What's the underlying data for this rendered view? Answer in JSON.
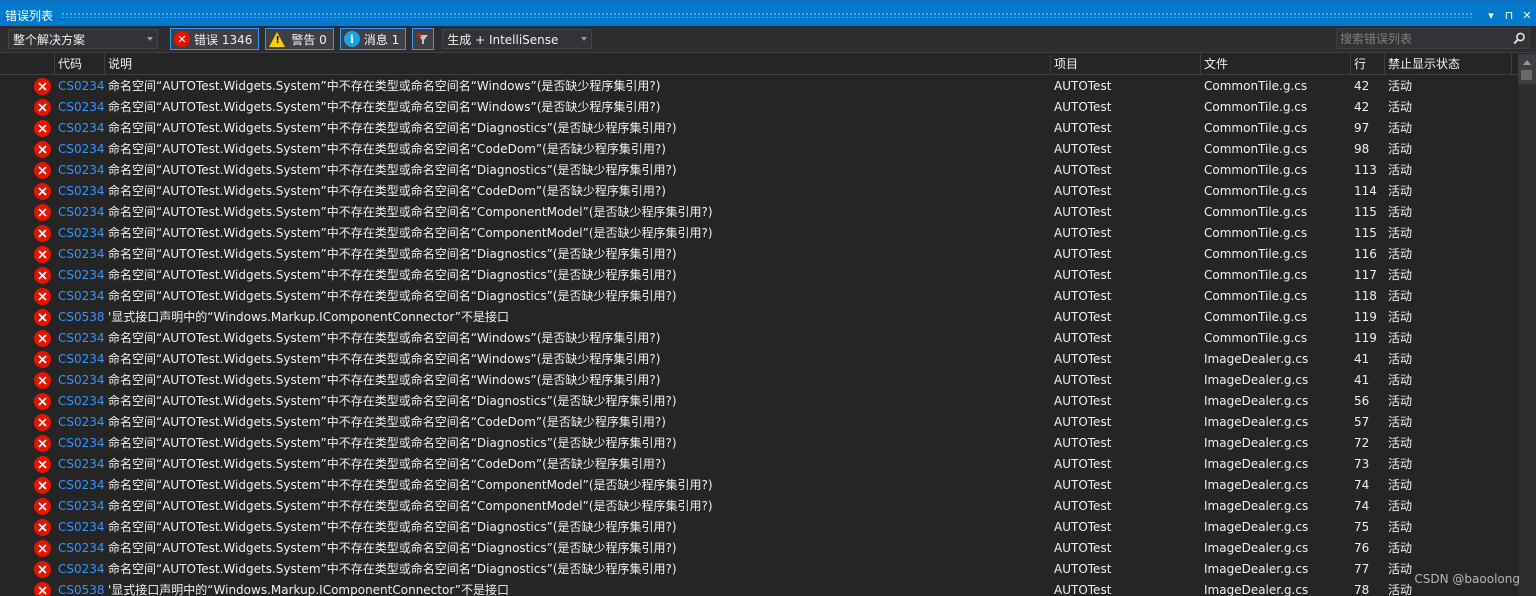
{
  "window": {
    "title": "错误列表",
    "buttons": [
      "▾",
      "⊓",
      "✕"
    ]
  },
  "toolbar": {
    "scope_dropdown": "整个解决方案",
    "errors_label": "错误 1346",
    "warnings_label": "警告 0",
    "messages_label": "消息 1",
    "source_dropdown": "生成 + IntelliSense",
    "search_placeholder": "搜索错误列表"
  },
  "columns": {
    "code": "代码",
    "description": "说明",
    "project": "项目",
    "file": "文件",
    "line": "行",
    "suppression": "禁止显示状态"
  },
  "rows": [
    {
      "code": "CS0234",
      "desc": "命名空间“AUTOTest.Widgets.System”中不存在类型或命名空间名“Windows”(是否缺少程序集引用?)",
      "project": "AUTOTest",
      "file": "CommonTile.g.cs",
      "line": "42",
      "state": "活动"
    },
    {
      "code": "CS0234",
      "desc": "命名空间“AUTOTest.Widgets.System”中不存在类型或命名空间名“Windows”(是否缺少程序集引用?)",
      "project": "AUTOTest",
      "file": "CommonTile.g.cs",
      "line": "42",
      "state": "活动"
    },
    {
      "code": "CS0234",
      "desc": "命名空间“AUTOTest.Widgets.System”中不存在类型或命名空间名“Diagnostics”(是否缺少程序集引用?)",
      "project": "AUTOTest",
      "file": "CommonTile.g.cs",
      "line": "97",
      "state": "活动"
    },
    {
      "code": "CS0234",
      "desc": "命名空间“AUTOTest.Widgets.System”中不存在类型或命名空间名“CodeDom”(是否缺少程序集引用?)",
      "project": "AUTOTest",
      "file": "CommonTile.g.cs",
      "line": "98",
      "state": "活动"
    },
    {
      "code": "CS0234",
      "desc": "命名空间“AUTOTest.Widgets.System”中不存在类型或命名空间名“Diagnostics”(是否缺少程序集引用?)",
      "project": "AUTOTest",
      "file": "CommonTile.g.cs",
      "line": "113",
      "state": "活动"
    },
    {
      "code": "CS0234",
      "desc": "命名空间“AUTOTest.Widgets.System”中不存在类型或命名空间名“CodeDom”(是否缺少程序集引用?)",
      "project": "AUTOTest",
      "file": "CommonTile.g.cs",
      "line": "114",
      "state": "活动"
    },
    {
      "code": "CS0234",
      "desc": "命名空间“AUTOTest.Widgets.System”中不存在类型或命名空间名“ComponentModel”(是否缺少程序集引用?)",
      "project": "AUTOTest",
      "file": "CommonTile.g.cs",
      "line": "115",
      "state": "活动"
    },
    {
      "code": "CS0234",
      "desc": "命名空间“AUTOTest.Widgets.System”中不存在类型或命名空间名“ComponentModel”(是否缺少程序集引用?)",
      "project": "AUTOTest",
      "file": "CommonTile.g.cs",
      "line": "115",
      "state": "活动"
    },
    {
      "code": "CS0234",
      "desc": "命名空间“AUTOTest.Widgets.System”中不存在类型或命名空间名“Diagnostics”(是否缺少程序集引用?)",
      "project": "AUTOTest",
      "file": "CommonTile.g.cs",
      "line": "116",
      "state": "活动"
    },
    {
      "code": "CS0234",
      "desc": "命名空间“AUTOTest.Widgets.System”中不存在类型或命名空间名“Diagnostics”(是否缺少程序集引用?)",
      "project": "AUTOTest",
      "file": "CommonTile.g.cs",
      "line": "117",
      "state": "活动"
    },
    {
      "code": "CS0234",
      "desc": "命名空间“AUTOTest.Widgets.System”中不存在类型或命名空间名“Diagnostics”(是否缺少程序集引用?)",
      "project": "AUTOTest",
      "file": "CommonTile.g.cs",
      "line": "118",
      "state": "活动"
    },
    {
      "code": "CS0538",
      "desc": "'显式接口声明中的“Windows.Markup.IComponentConnector”不是接口",
      "project": "AUTOTest",
      "file": "CommonTile.g.cs",
      "line": "119",
      "state": "活动"
    },
    {
      "code": "CS0234",
      "desc": "命名空间“AUTOTest.Widgets.System”中不存在类型或命名空间名“Windows”(是否缺少程序集引用?)",
      "project": "AUTOTest",
      "file": "CommonTile.g.cs",
      "line": "119",
      "state": "活动"
    },
    {
      "code": "CS0234",
      "desc": "命名空间“AUTOTest.Widgets.System”中不存在类型或命名空间名“Windows”(是否缺少程序集引用?)",
      "project": "AUTOTest",
      "file": "ImageDealer.g.cs",
      "line": "41",
      "state": "活动"
    },
    {
      "code": "CS0234",
      "desc": "命名空间“AUTOTest.Widgets.System”中不存在类型或命名空间名“Windows”(是否缺少程序集引用?)",
      "project": "AUTOTest",
      "file": "ImageDealer.g.cs",
      "line": "41",
      "state": "活动"
    },
    {
      "code": "CS0234",
      "desc": "命名空间“AUTOTest.Widgets.System”中不存在类型或命名空间名“Diagnostics”(是否缺少程序集引用?)",
      "project": "AUTOTest",
      "file": "ImageDealer.g.cs",
      "line": "56",
      "state": "活动"
    },
    {
      "code": "CS0234",
      "desc": "命名空间“AUTOTest.Widgets.System”中不存在类型或命名空间名“CodeDom”(是否缺少程序集引用?)",
      "project": "AUTOTest",
      "file": "ImageDealer.g.cs",
      "line": "57",
      "state": "活动"
    },
    {
      "code": "CS0234",
      "desc": "命名空间“AUTOTest.Widgets.System”中不存在类型或命名空间名“Diagnostics”(是否缺少程序集引用?)",
      "project": "AUTOTest",
      "file": "ImageDealer.g.cs",
      "line": "72",
      "state": "活动"
    },
    {
      "code": "CS0234",
      "desc": "命名空间“AUTOTest.Widgets.System”中不存在类型或命名空间名“CodeDom”(是否缺少程序集引用?)",
      "project": "AUTOTest",
      "file": "ImageDealer.g.cs",
      "line": "73",
      "state": "活动"
    },
    {
      "code": "CS0234",
      "desc": "命名空间“AUTOTest.Widgets.System”中不存在类型或命名空间名“ComponentModel”(是否缺少程序集引用?)",
      "project": "AUTOTest",
      "file": "ImageDealer.g.cs",
      "line": "74",
      "state": "活动"
    },
    {
      "code": "CS0234",
      "desc": "命名空间“AUTOTest.Widgets.System”中不存在类型或命名空间名“ComponentModel”(是否缺少程序集引用?)",
      "project": "AUTOTest",
      "file": "ImageDealer.g.cs",
      "line": "74",
      "state": "活动"
    },
    {
      "code": "CS0234",
      "desc": "命名空间“AUTOTest.Widgets.System”中不存在类型或命名空间名“Diagnostics”(是否缺少程序集引用?)",
      "project": "AUTOTest",
      "file": "ImageDealer.g.cs",
      "line": "75",
      "state": "活动"
    },
    {
      "code": "CS0234",
      "desc": "命名空间“AUTOTest.Widgets.System”中不存在类型或命名空间名“Diagnostics”(是否缺少程序集引用?)",
      "project": "AUTOTest",
      "file": "ImageDealer.g.cs",
      "line": "76",
      "state": "活动"
    },
    {
      "code": "CS0234",
      "desc": "命名空间“AUTOTest.Widgets.System”中不存在类型或命名空间名“Diagnostics”(是否缺少程序集引用?)",
      "project": "AUTOTest",
      "file": "ImageDealer.g.cs",
      "line": "77",
      "state": "活动"
    },
    {
      "code": "CS0538",
      "desc": "'显式接口声明中的“Windows.Markup.IComponentConnector”不是接口",
      "project": "AUTOTest",
      "file": "ImageDealer.g.cs",
      "line": "78",
      "state": "活动"
    }
  ],
  "watermark": "CSDN @baoolong",
  "colors": {
    "accent": "#007acc",
    "error": "#e51400",
    "warning": "#ffcc00",
    "info": "#1ba1e2",
    "code_link": "#3794ff",
    "background": "#252526"
  },
  "icons": {
    "row_icon": "error-icon",
    "search": "search-icon",
    "filter": "filter-icon"
  }
}
